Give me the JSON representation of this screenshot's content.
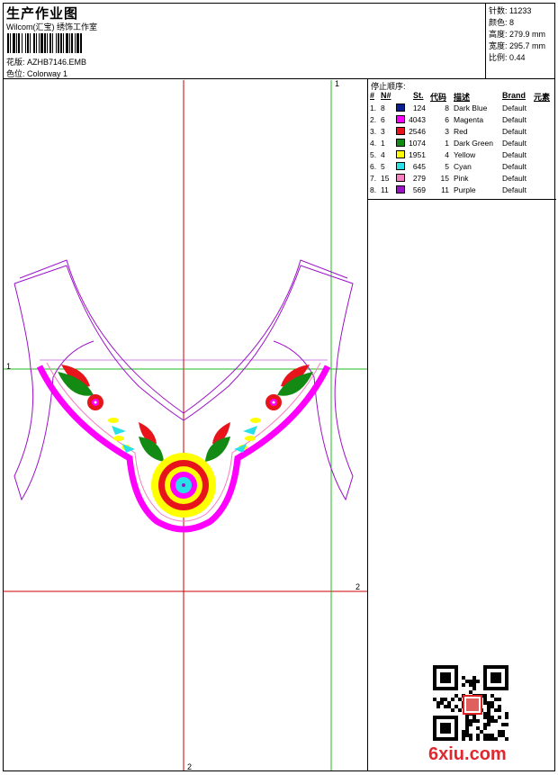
{
  "header": {
    "title": "生产作业图",
    "company": "Wilcom(汇宝) 绣饰工作室",
    "design_label": "花版:",
    "design_value": "AZHB7146.EMB",
    "colorway_label": "色位:",
    "colorway_value": "Colorway 1"
  },
  "stats": {
    "stitches": "针数: 11233",
    "colors": "颜色: 8",
    "height": "高度: 279.9 mm",
    "width": "宽度: 295.7 mm",
    "scale": "比例: 0.44"
  },
  "sequence": {
    "title": "停止顺序:",
    "headers": [
      "#",
      "N#",
      "St.",
      "代码",
      "描述",
      "Brand",
      "元素"
    ],
    "rows": [
      {
        "idx": "1.",
        "n": "8",
        "color": "#0a1f8f",
        "st": "124",
        "code": "8",
        "desc": "Dark Blue",
        "brand": "Default"
      },
      {
        "idx": "2.",
        "n": "6",
        "color": "#ff00ff",
        "st": "4043",
        "code": "6",
        "desc": "Magenta",
        "brand": "Default"
      },
      {
        "idx": "3.",
        "n": "3",
        "color": "#e8141b",
        "st": "2546",
        "code": "3",
        "desc": "Red",
        "brand": "Default"
      },
      {
        "idx": "4.",
        "n": "1",
        "color": "#138a13",
        "st": "1074",
        "code": "1",
        "desc": "Dark Green",
        "brand": "Default"
      },
      {
        "idx": "5.",
        "n": "4",
        "color": "#ffff00",
        "st": "1951",
        "code": "4",
        "desc": "Yellow",
        "brand": "Default"
      },
      {
        "idx": "6.",
        "n": "5",
        "color": "#29e0e8",
        "st": "645",
        "code": "5",
        "desc": "Cyan",
        "brand": "Default"
      },
      {
        "idx": "7.",
        "n": "15",
        "color": "#f77fbf",
        "st": "279",
        "code": "15",
        "desc": "Pink",
        "brand": "Default"
      },
      {
        "idx": "8.",
        "n": "11",
        "color": "#9b11c8",
        "st": "569",
        "code": "11",
        "desc": "Purple",
        "brand": "Default"
      }
    ]
  },
  "canvas": {
    "axis_labels": {
      "top_right": "1",
      "left": "1",
      "right": "2",
      "bottom": "2"
    },
    "line_color": "#cc0000",
    "green_line_color": "#22bb22"
  },
  "watermark": {
    "site": "6xiu.com"
  }
}
